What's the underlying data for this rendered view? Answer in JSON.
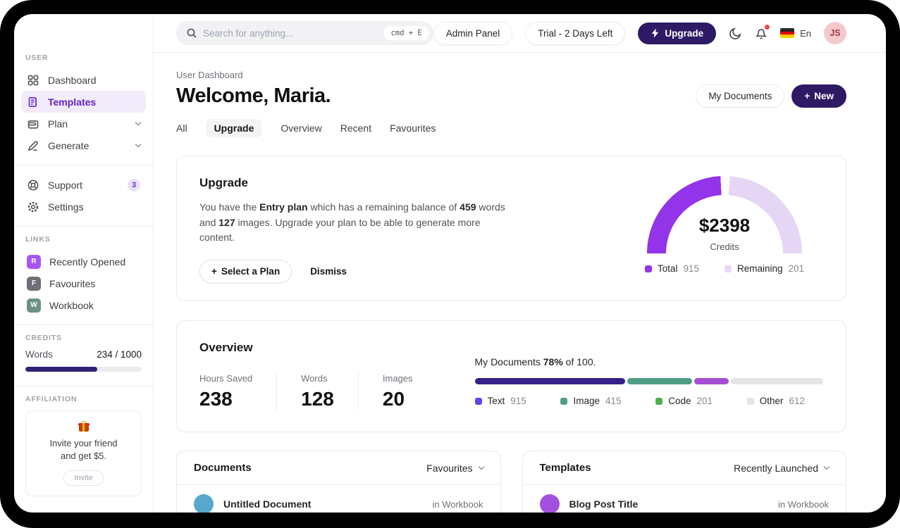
{
  "colors": {
    "accent_deep": "#2e1a64",
    "accent_purple": "#6d28d9",
    "gauge_total": "#9333ea",
    "gauge_remaining": "#e6d6f5",
    "credits_fill": "#2e2277",
    "notification_dot": "#ef4444"
  },
  "sidebar": {
    "user_label": "USER",
    "nav": [
      {
        "label": "Dashboard",
        "active": false
      },
      {
        "label": "Templates",
        "active": true
      },
      {
        "label": "Plan",
        "active": false,
        "expandable": true
      },
      {
        "label": "Generate",
        "active": false,
        "expandable": true
      }
    ],
    "secondary": [
      {
        "label": "Support",
        "badge": "3"
      },
      {
        "label": "Settings"
      }
    ],
    "links_label": "LINKS",
    "links": [
      {
        "initial": "R",
        "label": "Recently Opened",
        "color": "#a855f7"
      },
      {
        "initial": "F",
        "label": "Favourites",
        "color": "#6e7076"
      },
      {
        "initial": "W",
        "label": "Workbook",
        "color": "#6f9183"
      }
    ],
    "credits_label": "CREDITS",
    "credits": {
      "label": "Words",
      "value": "234 / 1000",
      "percent_filled": 62
    },
    "affiliation_label": "AFFILIATION",
    "affiliation": {
      "icon": "gift-icon",
      "text_line1": "Invite your friend",
      "text_line2": "and get $5.",
      "button_label": "Invite"
    }
  },
  "topbar": {
    "search_placeholder": "Search for anything...",
    "search_shortcut": "cmd + E",
    "admin_button": "Admin Panel",
    "trial_button": "Trial - 2 Days Left",
    "upgrade_button": "Upgrade",
    "icons": [
      "moon-icon",
      "bell-icon (red dot)",
      "german-flag"
    ],
    "language": "En",
    "avatar_initials": "JS"
  },
  "header": {
    "breadcrumb": "User Dashboard",
    "title": "Welcome, Maria.",
    "tabs": [
      "All",
      "Upgrade",
      "Overview",
      "Recent",
      "Favourites"
    ],
    "active_tab": "Upgrade",
    "my_documents_button": "My Documents",
    "new_button": "New"
  },
  "upgrade_card": {
    "title": "Upgrade",
    "text_parts": {
      "p1": "You have the ",
      "b1": "Entry plan",
      "p2": " which has a remaining balance of ",
      "b2": "459",
      "p3": " words and ",
      "b3": "127",
      "p4": " images. Upgrade your plan to be able to generate more content."
    },
    "select_plan_button": "Select a Plan",
    "dismiss_button": "Dismiss",
    "chart_data": {
      "type": "pie",
      "subtype": "half-donut-gauge",
      "center_value": "$2398",
      "center_label": "Credits",
      "series": [
        {
          "name": "Total",
          "value": 915,
          "color": "#9333ea"
        },
        {
          "name": "Remaining",
          "value": 201,
          "color": "#e6d6f5"
        }
      ],
      "visual": {
        "total_sweep_deg": 87,
        "gap_deg": 7,
        "full_deg": 180
      },
      "legend_position": "bottom"
    }
  },
  "overview_card": {
    "title": "Overview",
    "stats": [
      {
        "label": "Hours Saved",
        "value": "238"
      },
      {
        "label": "Words",
        "value": "128"
      },
      {
        "label": "Images",
        "value": "20"
      }
    ],
    "progress_heading": {
      "p1": "My Documents ",
      "b1": "78%",
      "p2": " of 100."
    },
    "chart_data": {
      "type": "bar",
      "subtype": "stacked-progress",
      "title": "My Documents 78% of 100.",
      "percent_complete": 78,
      "total": 100,
      "segments": [
        {
          "name": "Text",
          "value": 915,
          "bar_color": "#36208a",
          "legend_color": "#5e45f2",
          "width_pct": 44
        },
        {
          "name": "Image",
          "value": 415,
          "bar_color": "#4f9e85",
          "legend_color": "#4f9e85",
          "width_pct": 19
        },
        {
          "name": "Code",
          "value": 201,
          "bar_color": "#a34fd0",
          "legend_color": "#4caf50",
          "width_pct": 10
        },
        {
          "name": "Other",
          "value": 612,
          "bar_color": "#e4e4e7",
          "legend_color": "#e4e4e7",
          "width_pct": 27
        }
      ],
      "legend_position": "bottom"
    }
  },
  "documents_card": {
    "title": "Documents",
    "filter_label": "Favourites",
    "items": [
      {
        "name": "Untitled Document",
        "location": "in Workbook",
        "avatar_color": "#57a8cb"
      }
    ]
  },
  "templates_card": {
    "title": "Templates",
    "filter_label": "Recently Launched",
    "items": [
      {
        "name": "Blog Post Title",
        "location": "in Workbook",
        "avatar_color": "#a34fe0"
      }
    ]
  }
}
